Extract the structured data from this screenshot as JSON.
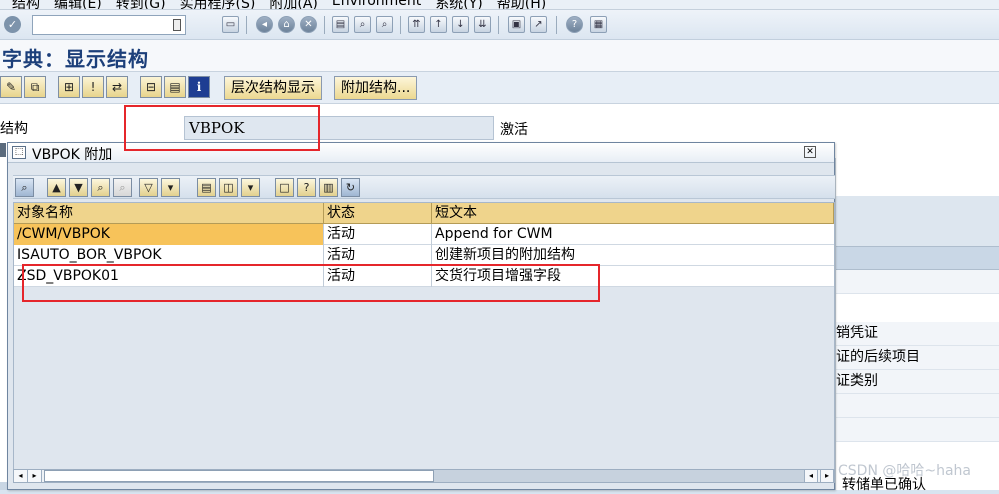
{
  "menubar": {
    "items": [
      "结构",
      "编辑(E)",
      "转到(G)",
      "实用程序(S)",
      "附加(A)",
      "Environment",
      "系统(Y)",
      "帮助(H)"
    ]
  },
  "toolbar": {
    "command_value": ""
  },
  "title": "字典：显示结构",
  "app_toolbar": {
    "btn_hierarchy": "层次结构显示",
    "btn_append": "附加结构..."
  },
  "structure": {
    "label": "结构",
    "value": "VBPOK",
    "status": "激活"
  },
  "dialog": {
    "title": "VBPOK 附加",
    "columns": [
      "对象名称",
      "状态",
      "短文本"
    ],
    "rows": [
      [
        "/CWM/VBPOK",
        "活动",
        "Append for CWM"
      ],
      [
        "ISAUTO_BOR_VBPOK",
        "活动",
        "创建新项目的附加结构"
      ],
      [
        "ZSD_VBPOK01",
        "活动",
        "交货行项目增强字段"
      ]
    ]
  },
  "background_right": [
    "销凭证",
    "证的后续项目",
    "证类别",
    "转储单已确认"
  ],
  "watermark": "CSDN @哈哈~haha",
  "colors": {
    "annotation": "#e5262b",
    "header": "#efd48c",
    "selection": "#f7c35a",
    "title": "#1c3f7a"
  },
  "icons": {
    "menu": "enter-check-icon",
    "toolbar": [
      "save-icon",
      "back-icon",
      "exit-icon",
      "cancel-icon",
      "print-icon",
      "find-icon",
      "find-next-icon",
      "first-page-icon",
      "prev-page-icon",
      "next-page-icon",
      "last-page-icon",
      "new-session-icon",
      "shortcut-icon",
      "help-icon",
      "layout-icon"
    ]
  }
}
